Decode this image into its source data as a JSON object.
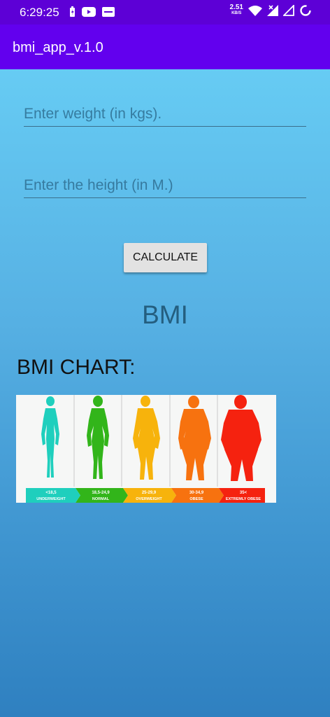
{
  "status_bar": {
    "time": "6:29:25",
    "speed_value": "2.51",
    "speed_unit": "KB/S",
    "left_icons": [
      "battery-charging-icon",
      "youtube-icon",
      "gallery-icon"
    ],
    "right_icons": [
      "wifi-icon",
      "signal-icon",
      "signal-empty-icon",
      "sync-icon"
    ]
  },
  "appbar": {
    "title": "bmi_app_v.1.0",
    "color": "#6200ee"
  },
  "form": {
    "weight_placeholder": "Enter weight (in kgs).",
    "height_placeholder": "Enter the height (in M.)",
    "calculate_label": "CALCULATE"
  },
  "result": {
    "label": "BMI"
  },
  "chart": {
    "heading": "BMI CHART:",
    "categories": [
      {
        "range": "<18,5",
        "label": "UNDERWEIGHT",
        "color": "#1fcfbd"
      },
      {
        "range": "18,5-24,9",
        "label": "NORMAL",
        "color": "#32b51a"
      },
      {
        "range": "25-29,9",
        "label": "OVERWEIGHT",
        "color": "#f7b30c"
      },
      {
        "range": "30-34,9",
        "label": "OBESE",
        "color": "#f7720f"
      },
      {
        "range": "35<",
        "label": "EXTREMLY OBESE",
        "color": "#f5220f"
      }
    ]
  }
}
